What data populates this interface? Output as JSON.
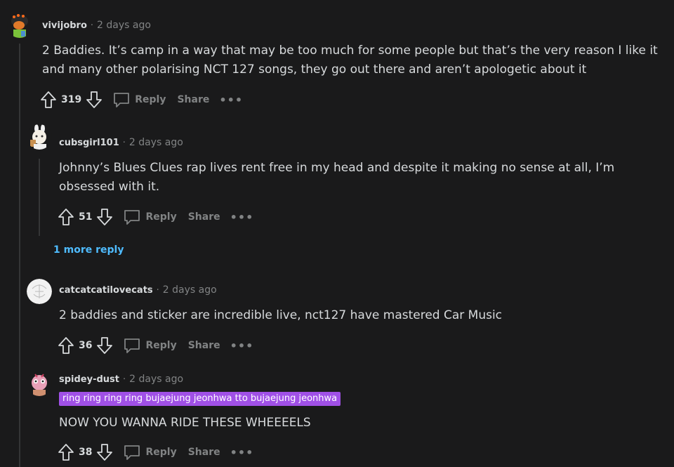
{
  "comments": [
    {
      "username": "vivijobro",
      "time": "2 days ago",
      "body": "2 Baddies. It’s camp in a way that may be too much for some people but that’s the very reason I like it and many other polarising NCT 127 songs, they go out there and aren’t apologetic about it",
      "votes": "319",
      "reply_label": "Reply",
      "share_label": "Share",
      "more_label": "•••"
    },
    {
      "username": "cubsgirl101",
      "time": "2 days ago",
      "body": "Johnny’s Blues Clues rap lives rent free in my head and despite it making no sense at all, I’m obsessed with it.",
      "votes": "51",
      "reply_label": "Reply",
      "share_label": "Share",
      "more_label": "•••"
    },
    {
      "username": "catcatcatilovecats",
      "time": "2 days ago",
      "body": "2 baddies and sticker are incredible live, nct127 have mastered Car Music",
      "votes": "36",
      "reply_label": "Reply",
      "share_label": "Share",
      "more_label": "•••"
    },
    {
      "username": "spidey-dust",
      "time": "2 days ago",
      "flair": "ring ring ring ring bujaejung jeonhwa tto bujaejung jeonhwa",
      "body": "NOW YOU WANNA RIDE THESE WHEEEELS",
      "votes": "38",
      "reply_label": "Reply",
      "share_label": "Share",
      "more_label": "•••"
    }
  ],
  "more_replies": "1 more reply",
  "separator": "·",
  "colors": {
    "background": "#1a1a1b",
    "text": "#d7dadc",
    "muted": "#818384",
    "link": "#4fbcff",
    "flair": "#a050e6"
  }
}
